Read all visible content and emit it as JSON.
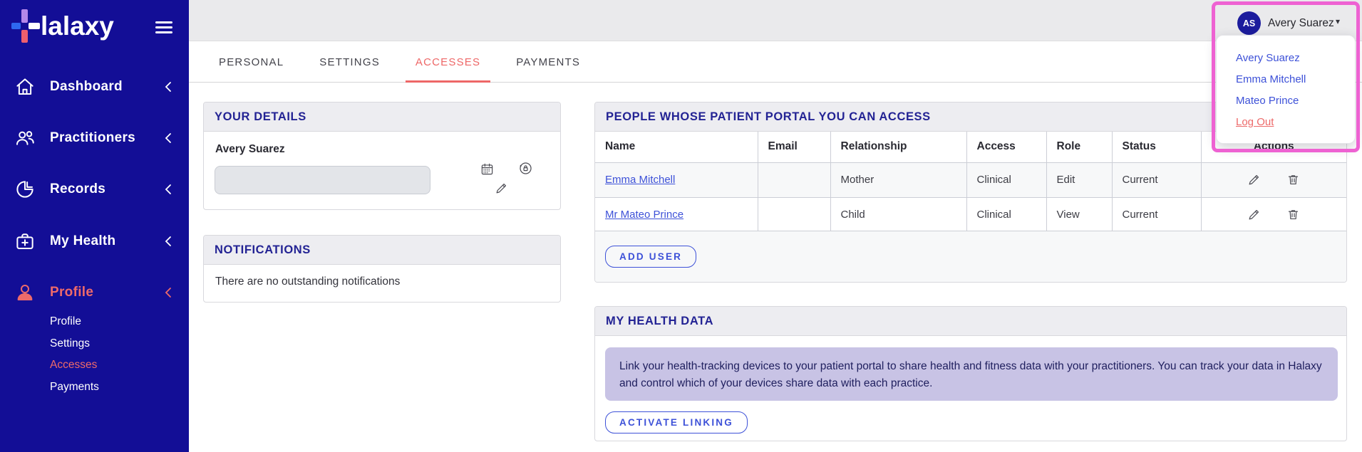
{
  "brand": {
    "name": "Halaxy",
    "wordmark": "lalaxy"
  },
  "colors": {
    "sidebar_navy": "#130e96",
    "accent_red": "#ee6767",
    "link_blue": "#3d51d8",
    "heading_navy": "#232394",
    "highlight_pink": "#ee62d2",
    "info_lavender": "#c8c3e5"
  },
  "sidebar": {
    "items": [
      {
        "label": "Dashboard",
        "icon": "home-icon",
        "active": false
      },
      {
        "label": "Practitioners",
        "icon": "practitioners-icon",
        "active": false
      },
      {
        "label": "Records",
        "icon": "records-icon",
        "active": false
      },
      {
        "label": "My Health",
        "icon": "my-health-icon",
        "active": false
      },
      {
        "label": "Profile",
        "icon": "profile-icon",
        "active": true
      }
    ],
    "subitems": [
      {
        "label": "Profile",
        "active": false
      },
      {
        "label": "Settings",
        "active": false
      },
      {
        "label": "Accesses",
        "active": true
      },
      {
        "label": "Payments",
        "active": false
      }
    ]
  },
  "tabs": [
    {
      "label": "PERSONAL",
      "active": false
    },
    {
      "label": "SETTINGS",
      "active": false
    },
    {
      "label": "ACCESSES",
      "active": true
    },
    {
      "label": "PAYMENTS",
      "active": false
    }
  ],
  "user_menu": {
    "initials": "AS",
    "name": "Avery Suarez",
    "caret": "▾",
    "dropdown_items": [
      "Avery Suarez",
      "Emma Mitchell",
      "Mateo Prince"
    ],
    "logout_label": "Log Out"
  },
  "your_details": {
    "title": "YOUR DETAILS",
    "name": "Avery Suarez",
    "input_value": ""
  },
  "notifications": {
    "title": "NOTIFICATIONS",
    "message": "There are no outstanding notifications"
  },
  "portal_access": {
    "title": "PEOPLE WHOSE PATIENT PORTAL YOU CAN ACCESS",
    "columns": [
      "Name",
      "Email",
      "Relationship",
      "Access",
      "Role",
      "Status",
      "Actions"
    ],
    "rows": [
      {
        "name": "Emma Mitchell",
        "email": "",
        "relationship": "Mother",
        "access": "Clinical",
        "role": "Edit",
        "status": "Current"
      },
      {
        "name": "Mr Mateo Prince",
        "email": "",
        "relationship": "Child",
        "access": "Clinical",
        "role": "View",
        "status": "Current"
      }
    ],
    "add_button_label": "ADD USER"
  },
  "my_health_data": {
    "title": "MY HEALTH DATA",
    "info_text": "Link your health-tracking devices to your patient portal to share health and fitness data with your practitioners. You can track your data in Halaxy and control which of your devices share data with each practice.",
    "activate_button_label": "ACTIVATE LINKING"
  }
}
